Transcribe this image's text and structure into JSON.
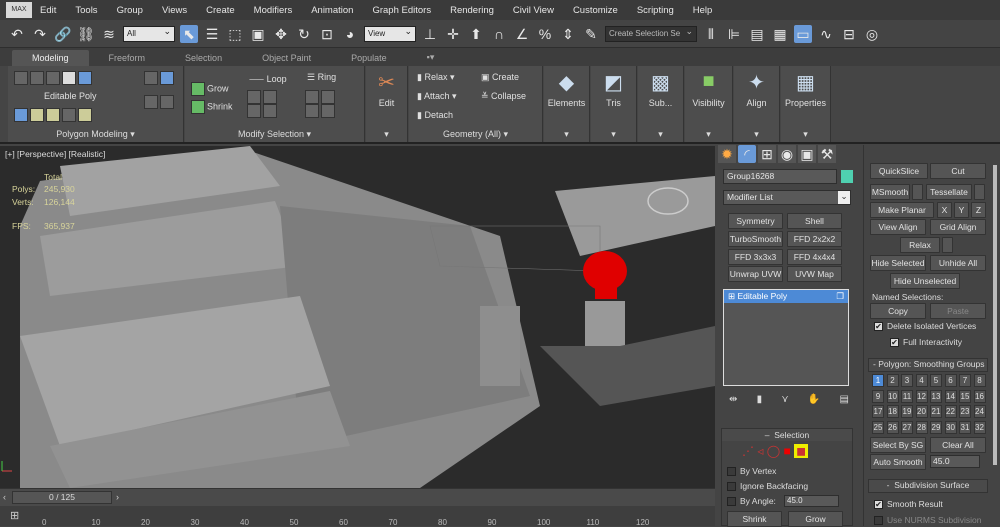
{
  "menu": {
    "logo": "MAX",
    "items": [
      "Edit",
      "Tools",
      "Group",
      "Views",
      "Create",
      "Modifiers",
      "Animation",
      "Graph Editors",
      "Rendering",
      "Civil View",
      "Customize",
      "Scripting",
      "Help"
    ]
  },
  "toolbar": {
    "filter": "All",
    "refcoord": "View",
    "selection_set": "Create Selection Se"
  },
  "ribbon_tabs": [
    "Modeling",
    "Freeform",
    "Selection",
    "Object Paint",
    "Populate"
  ],
  "ribbon": {
    "polygon_modeling": {
      "title": "Polygon Modeling",
      "label": "Editable Poly"
    },
    "modify_selection": {
      "title": "Modify Selection",
      "grow": "Grow",
      "shrink": "Shrink",
      "loop": "Loop",
      "ring": "Ring"
    },
    "edit": {
      "label": "Edit"
    },
    "geometry": {
      "title": "Geometry (All)",
      "relax": "Relax",
      "attach": "Attach",
      "detach": "Detach",
      "create": "Create",
      "collapse": "Collapse"
    },
    "panels": [
      "Elements",
      "Tris",
      "Sub...",
      "Visibility",
      "Align",
      "Properties"
    ]
  },
  "viewport": {
    "label": "[+] [Perspective] [Realistic]",
    "stats_header": "Total",
    "polys_label": "Polys:",
    "polys": "245,930",
    "verts_label": "Verts:",
    "verts": "126,144",
    "fps_label": "FPS:",
    "fps": "365,937"
  },
  "command_panel": {
    "object_name": "Group16268",
    "object_color": "#4fd0b0",
    "modifier_list": "Modifier List",
    "modifier_buttons": [
      "Symmetry",
      "Shell",
      "TurboSmooth",
      "FFD 2x2x2",
      "FFD 3x3x3",
      "FFD 4x4x4",
      "Unwrap UVW",
      "UVW Map"
    ],
    "stack": [
      "Editable Poly"
    ],
    "selection": {
      "title": "Selection",
      "by_vertex": "By Vertex",
      "ignore_backfacing": "Ignore Backfacing",
      "by_angle": "By Angle:",
      "angle": "45.0",
      "shrink": "Shrink",
      "grow": "Grow"
    },
    "edit_geometry": {
      "quickslice": "QuickSlice",
      "cut": "Cut",
      "msmooth": "MSmooth",
      "tessellate": "Tessellate",
      "make_planar": "Make Planar",
      "x": "X",
      "y": "Y",
      "z": "Z",
      "view_align": "View Align",
      "grid_align": "Grid Align",
      "relax": "Relax",
      "hide_selected": "Hide Selected",
      "unhide_all": "Unhide All",
      "hide_unselected": "Hide Unselected",
      "named_selections": "Named Selections:",
      "copy": "Copy",
      "paste": "Paste",
      "delete_isolated": "Delete Isolated Vertices",
      "full_interactivity": "Full Interactivity"
    },
    "smoothing": {
      "title": "Polygon: Smoothing Groups",
      "groups": [
        "1",
        "2",
        "3",
        "4",
        "5",
        "6",
        "7",
        "8",
        "9",
        "10",
        "11",
        "12",
        "13",
        "14",
        "15",
        "16",
        "17",
        "18",
        "19",
        "20",
        "21",
        "22",
        "23",
        "24",
        "25",
        "26",
        "27",
        "28",
        "29",
        "30",
        "31",
        "32"
      ],
      "active": "1",
      "select_by_sg": "Select By SG",
      "clear_all": "Clear All",
      "auto_smooth": "Auto Smooth",
      "threshold": "45.0"
    },
    "subdivision": {
      "title": "Subdivision Surface",
      "smooth_result": "Smooth Result",
      "use_nurms": "Use NURMS Subdivision"
    }
  },
  "timeline": {
    "frame": "0 / 125",
    "ticks": [
      "0",
      "10",
      "20",
      "30",
      "40",
      "50",
      "60",
      "70",
      "80",
      "90",
      "100",
      "110",
      "120"
    ]
  }
}
